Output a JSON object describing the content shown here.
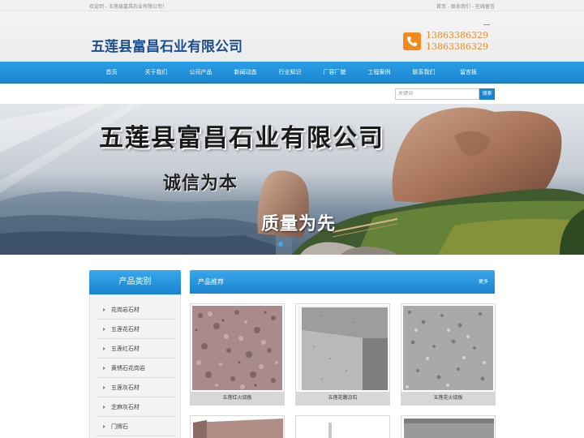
{
  "topbar": {
    "welcome": "欢迎到 - 五莲县富昌石业有限公司！",
    "links": [
      "首页",
      "联系我们",
      "在线留言"
    ],
    "separator": " - "
  },
  "header": {
    "company_name": "五莲县富昌石业有限公司",
    "phone_icon": "phone-icon",
    "phones": [
      "13863386329",
      "13863386329"
    ]
  },
  "nav": {
    "items": [
      "首页",
      "关于我们",
      "公司产品",
      "新闻动态",
      "行业知识",
      "厂容厂貌",
      "工程案例",
      "联系我们",
      "留言板"
    ]
  },
  "search": {
    "placeholder": "关键词",
    "button": "搜索"
  },
  "banner": {
    "title": "五莲县富昌石业有限公司",
    "slogan1": "诚信为本",
    "slogan2": "质量为先"
  },
  "sidebar": {
    "title": "产品类别",
    "items": [
      "花岗岩石材",
      "五莲花石材",
      "五莲红石材",
      "黄锈石花岗岩",
      "五莲灰石材",
      "芝麻灰石材",
      "门牌石"
    ]
  },
  "products": {
    "title": "产品推荐",
    "more": "更多",
    "items": [
      {
        "caption": "五莲红火烧板"
      },
      {
        "caption": "五莲花路沿石"
      },
      {
        "caption": "五莲花火烧板"
      }
    ]
  },
  "colors": {
    "nav_blue": "#1a84cf",
    "accent_orange": "#f08a1c",
    "logo_blue": "#1d4f8f"
  }
}
